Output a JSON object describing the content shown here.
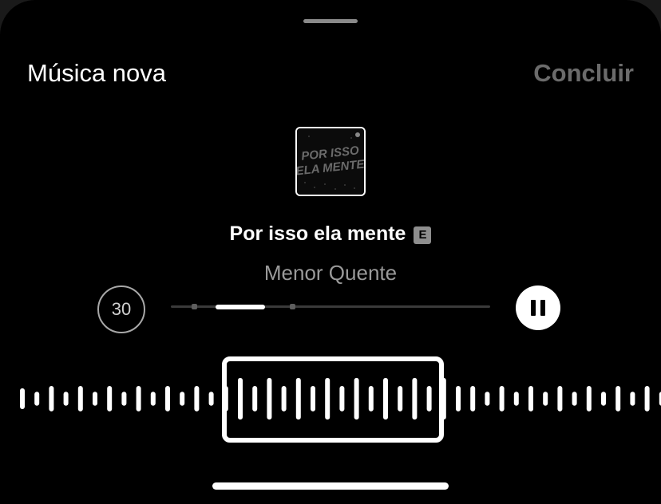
{
  "header": {
    "title": "Música nova",
    "done_label": "Concluir"
  },
  "track": {
    "title": "Por isso ela mente",
    "explicit_badge": "E",
    "artist": "Menor Quente",
    "album_art_text": [
      "POR ISSO",
      "ELA MENTE"
    ],
    "clip_duration": "30"
  },
  "waveform": {
    "bar_heights": [
      0.45,
      0.3,
      0.55,
      0.3,
      0.55,
      0.3,
      0.55,
      0.3,
      0.55,
      0.3,
      0.55,
      0.3,
      0.55,
      0.3,
      0.55,
      0.9,
      0.55,
      0.9,
      0.55,
      0.9,
      0.55,
      0.9,
      0.55,
      0.9,
      0.55,
      0.9,
      0.55,
      0.9,
      0.55,
      0.9,
      0.55,
      0.55,
      0.3,
      0.55,
      0.3,
      0.55,
      0.3,
      0.55,
      0.3,
      0.55,
      0.3,
      0.55,
      0.3,
      0.55,
      0.3
    ]
  },
  "icons": {
    "pause": "pause-icon",
    "grabber": "grabber-icon"
  }
}
